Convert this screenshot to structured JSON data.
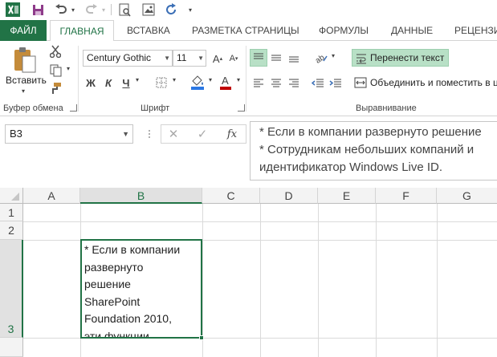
{
  "qat": {
    "icons": [
      "excel-app-icon",
      "save-icon",
      "undo-icon",
      "redo-icon",
      "print-preview-icon",
      "insert-image-icon",
      "refresh-icon",
      "customize-qat-icon"
    ]
  },
  "tabs": {
    "file": "ФАЙЛ",
    "items": [
      "ГЛАВНАЯ",
      "ВСТАВКА",
      "РАЗМЕТКА СТРАНИЦЫ",
      "ФОРМУЛЫ",
      "ДАННЫЕ",
      "РЕЦЕНЗИ"
    ],
    "active": "ГЛАВНАЯ"
  },
  "ribbon": {
    "clipboard": {
      "paste_label": "Вставить",
      "group_label": "Буфер обмена"
    },
    "font": {
      "family": "Century Gothic",
      "size": "11",
      "bold": "Ж",
      "italic": "К",
      "underline": "Ч",
      "group_label": "Шрифт"
    },
    "alignment": {
      "wrap_text": "Перенести текст",
      "merge_center": "Объединить и поместить в ц",
      "group_label": "Выравнивание"
    }
  },
  "formula_bar": {
    "name_box": "B3",
    "fx": "fx",
    "lines": [
      "* Если в компании развернуто решение",
      "* Сотрудникам небольших компаний и",
      "идентификатор Windows Live ID."
    ]
  },
  "grid": {
    "columns": [
      "A",
      "B",
      "C",
      "D",
      "E",
      "F",
      "G"
    ],
    "rows": [
      "1",
      "2",
      "3"
    ],
    "selected_cell": "B3",
    "cell_b3_lines": [
      "* Если в компании",
      "развернуто",
      "решение",
      "SharePoint",
      "Foundation 2010,",
      "эти функции"
    ]
  },
  "colors": {
    "accent": "#217346",
    "highlight": "#b8e0c6"
  }
}
